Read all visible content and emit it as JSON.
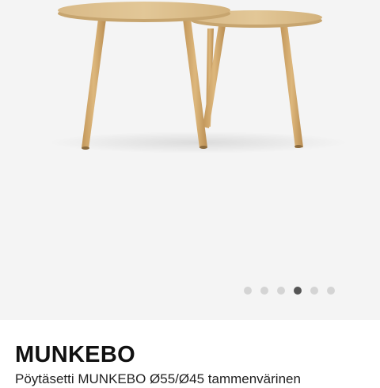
{
  "gallery": {
    "image_alt": "Sohvapöytäsetti MUNKEBO",
    "image_count": 6,
    "active_index": 3,
    "colors": {
      "background": "#f4f4f4",
      "wood_top": "#dcbf8e",
      "wood_edge": "#c7a56f",
      "leg": "#d2a86b",
      "dot_inactive": "#d4d4d4",
      "dot_active": "#555555"
    }
  },
  "product": {
    "name": "MUNKEBO",
    "description": "Pöytäsetti MUNKEBO Ø55/Ø45 tammenvärinen"
  }
}
